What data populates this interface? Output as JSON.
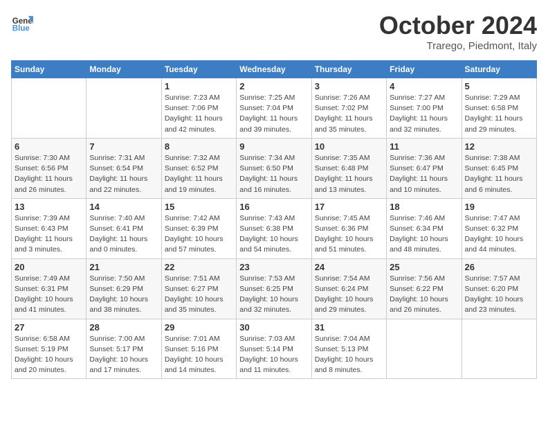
{
  "header": {
    "logo_general": "General",
    "logo_blue": "Blue",
    "month": "October 2024",
    "location": "Trarego, Piedmont, Italy"
  },
  "days_of_week": [
    "Sunday",
    "Monday",
    "Tuesday",
    "Wednesday",
    "Thursday",
    "Friday",
    "Saturday"
  ],
  "weeks": [
    [
      {
        "day": "",
        "info": ""
      },
      {
        "day": "",
        "info": ""
      },
      {
        "day": "1",
        "info": "Sunrise: 7:23 AM\nSunset: 7:06 PM\nDaylight: 11 hours and 42 minutes."
      },
      {
        "day": "2",
        "info": "Sunrise: 7:25 AM\nSunset: 7:04 PM\nDaylight: 11 hours and 39 minutes."
      },
      {
        "day": "3",
        "info": "Sunrise: 7:26 AM\nSunset: 7:02 PM\nDaylight: 11 hours and 35 minutes."
      },
      {
        "day": "4",
        "info": "Sunrise: 7:27 AM\nSunset: 7:00 PM\nDaylight: 11 hours and 32 minutes."
      },
      {
        "day": "5",
        "info": "Sunrise: 7:29 AM\nSunset: 6:58 PM\nDaylight: 11 hours and 29 minutes."
      }
    ],
    [
      {
        "day": "6",
        "info": "Sunrise: 7:30 AM\nSunset: 6:56 PM\nDaylight: 11 hours and 26 minutes."
      },
      {
        "day": "7",
        "info": "Sunrise: 7:31 AM\nSunset: 6:54 PM\nDaylight: 11 hours and 22 minutes."
      },
      {
        "day": "8",
        "info": "Sunrise: 7:32 AM\nSunset: 6:52 PM\nDaylight: 11 hours and 19 minutes."
      },
      {
        "day": "9",
        "info": "Sunrise: 7:34 AM\nSunset: 6:50 PM\nDaylight: 11 hours and 16 minutes."
      },
      {
        "day": "10",
        "info": "Sunrise: 7:35 AM\nSunset: 6:48 PM\nDaylight: 11 hours and 13 minutes."
      },
      {
        "day": "11",
        "info": "Sunrise: 7:36 AM\nSunset: 6:47 PM\nDaylight: 11 hours and 10 minutes."
      },
      {
        "day": "12",
        "info": "Sunrise: 7:38 AM\nSunset: 6:45 PM\nDaylight: 11 hours and 6 minutes."
      }
    ],
    [
      {
        "day": "13",
        "info": "Sunrise: 7:39 AM\nSunset: 6:43 PM\nDaylight: 11 hours and 3 minutes."
      },
      {
        "day": "14",
        "info": "Sunrise: 7:40 AM\nSunset: 6:41 PM\nDaylight: 11 hours and 0 minutes."
      },
      {
        "day": "15",
        "info": "Sunrise: 7:42 AM\nSunset: 6:39 PM\nDaylight: 10 hours and 57 minutes."
      },
      {
        "day": "16",
        "info": "Sunrise: 7:43 AM\nSunset: 6:38 PM\nDaylight: 10 hours and 54 minutes."
      },
      {
        "day": "17",
        "info": "Sunrise: 7:45 AM\nSunset: 6:36 PM\nDaylight: 10 hours and 51 minutes."
      },
      {
        "day": "18",
        "info": "Sunrise: 7:46 AM\nSunset: 6:34 PM\nDaylight: 10 hours and 48 minutes."
      },
      {
        "day": "19",
        "info": "Sunrise: 7:47 AM\nSunset: 6:32 PM\nDaylight: 10 hours and 44 minutes."
      }
    ],
    [
      {
        "day": "20",
        "info": "Sunrise: 7:49 AM\nSunset: 6:31 PM\nDaylight: 10 hours and 41 minutes."
      },
      {
        "day": "21",
        "info": "Sunrise: 7:50 AM\nSunset: 6:29 PM\nDaylight: 10 hours and 38 minutes."
      },
      {
        "day": "22",
        "info": "Sunrise: 7:51 AM\nSunset: 6:27 PM\nDaylight: 10 hours and 35 minutes."
      },
      {
        "day": "23",
        "info": "Sunrise: 7:53 AM\nSunset: 6:25 PM\nDaylight: 10 hours and 32 minutes."
      },
      {
        "day": "24",
        "info": "Sunrise: 7:54 AM\nSunset: 6:24 PM\nDaylight: 10 hours and 29 minutes."
      },
      {
        "day": "25",
        "info": "Sunrise: 7:56 AM\nSunset: 6:22 PM\nDaylight: 10 hours and 26 minutes."
      },
      {
        "day": "26",
        "info": "Sunrise: 7:57 AM\nSunset: 6:20 PM\nDaylight: 10 hours and 23 minutes."
      }
    ],
    [
      {
        "day": "27",
        "info": "Sunrise: 6:58 AM\nSunset: 5:19 PM\nDaylight: 10 hours and 20 minutes."
      },
      {
        "day": "28",
        "info": "Sunrise: 7:00 AM\nSunset: 5:17 PM\nDaylight: 10 hours and 17 minutes."
      },
      {
        "day": "29",
        "info": "Sunrise: 7:01 AM\nSunset: 5:16 PM\nDaylight: 10 hours and 14 minutes."
      },
      {
        "day": "30",
        "info": "Sunrise: 7:03 AM\nSunset: 5:14 PM\nDaylight: 10 hours and 11 minutes."
      },
      {
        "day": "31",
        "info": "Sunrise: 7:04 AM\nSunset: 5:13 PM\nDaylight: 10 hours and 8 minutes."
      },
      {
        "day": "",
        "info": ""
      },
      {
        "day": "",
        "info": ""
      }
    ]
  ]
}
